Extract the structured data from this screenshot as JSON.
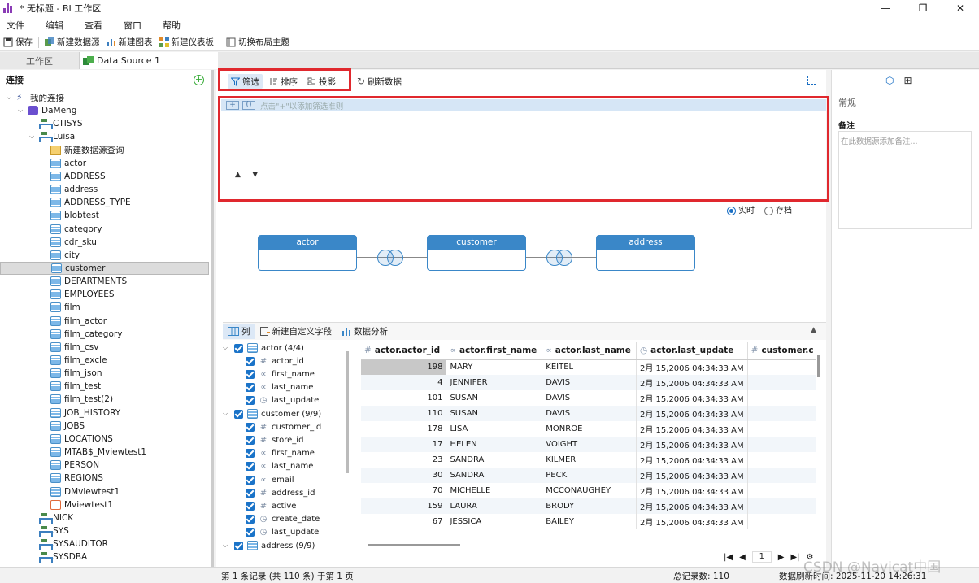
{
  "window": {
    "title": "* 无标题 - BI 工作区"
  },
  "menu": [
    "文件",
    "编辑",
    "查看",
    "窗口",
    "帮助"
  ],
  "toolbar": {
    "save": "保存",
    "new_source": "新建数据源",
    "new_chart": "新建图表",
    "new_dashboard": "新建仪表板",
    "switch_theme": "切换布局主题"
  },
  "tabs": {
    "workspace": "工作区",
    "datasource": "Data Source 1"
  },
  "left": {
    "header": "连接",
    "tree": [
      {
        "label": "我的连接",
        "level": 0,
        "icon": "plug",
        "expanded": true
      },
      {
        "label": "DaMeng",
        "level": 1,
        "icon": "conn",
        "expanded": true
      },
      {
        "label": "CTISYS",
        "level": 2,
        "icon": "schema"
      },
      {
        "label": "Luisa",
        "level": 2,
        "icon": "schema",
        "expanded": true
      },
      {
        "label": "新建数据源查询",
        "level": 3,
        "icon": "query"
      },
      {
        "label": "actor",
        "level": 3,
        "icon": "table"
      },
      {
        "label": "ADDRESS",
        "level": 3,
        "icon": "table"
      },
      {
        "label": "address",
        "level": 3,
        "icon": "table"
      },
      {
        "label": "ADDRESS_TYPE",
        "level": 3,
        "icon": "table"
      },
      {
        "label": "blobtest",
        "level": 3,
        "icon": "table"
      },
      {
        "label": "category",
        "level": 3,
        "icon": "table"
      },
      {
        "label": "cdr_sku",
        "level": 3,
        "icon": "table"
      },
      {
        "label": "city",
        "level": 3,
        "icon": "table"
      },
      {
        "label": "customer",
        "level": 3,
        "icon": "table",
        "selected": true
      },
      {
        "label": "DEPARTMENTS",
        "level": 3,
        "icon": "table"
      },
      {
        "label": "EMPLOYEES",
        "level": 3,
        "icon": "table"
      },
      {
        "label": "film",
        "level": 3,
        "icon": "table"
      },
      {
        "label": "film_actor",
        "level": 3,
        "icon": "table"
      },
      {
        "label": "film_category",
        "level": 3,
        "icon": "table"
      },
      {
        "label": "film_csv",
        "level": 3,
        "icon": "table"
      },
      {
        "label": "film_excle",
        "level": 3,
        "icon": "table"
      },
      {
        "label": "film_json",
        "level": 3,
        "icon": "table"
      },
      {
        "label": "film_test",
        "level": 3,
        "icon": "table"
      },
      {
        "label": "film_test(2)",
        "level": 3,
        "icon": "table"
      },
      {
        "label": "JOB_HISTORY",
        "level": 3,
        "icon": "table"
      },
      {
        "label": "JOBS",
        "level": 3,
        "icon": "table"
      },
      {
        "label": "LOCATIONS",
        "level": 3,
        "icon": "table"
      },
      {
        "label": "MTAB$_Mviewtest1",
        "level": 3,
        "icon": "table"
      },
      {
        "label": "PERSON",
        "level": 3,
        "icon": "table"
      },
      {
        "label": "REGIONS",
        "level": 3,
        "icon": "table"
      },
      {
        "label": "DMviewtest1",
        "level": 3,
        "icon": "table"
      },
      {
        "label": "Mviewtest1",
        "level": 3,
        "icon": "view"
      },
      {
        "label": "NICK",
        "level": 2,
        "icon": "schema"
      },
      {
        "label": "SYS",
        "level": 2,
        "icon": "schema"
      },
      {
        "label": "SYSAUDITOR",
        "level": 2,
        "icon": "schema"
      },
      {
        "label": "SYSDBA",
        "level": 2,
        "icon": "schema"
      }
    ]
  },
  "main": {
    "tools": {
      "filter": "筛选",
      "sort": "排序",
      "project": "投影",
      "refresh": "刷新数据"
    },
    "filter_hint": "点击\"+\"以添加筛选准则",
    "mode": {
      "realtime": "实时",
      "archive": "存档"
    },
    "nodes": [
      "actor",
      "customer",
      "address"
    ],
    "bottom_tabs": {
      "columns": "列",
      "new_field": "新建自定义字段",
      "analysis": "数据分析"
    },
    "fields": [
      {
        "label": "actor (4/4)",
        "group": true
      },
      {
        "label": "actor_id",
        "icon": "#"
      },
      {
        "label": "first_name",
        "icon": "abc"
      },
      {
        "label": "last_name",
        "icon": "abc"
      },
      {
        "label": "last_update",
        "icon": "clock"
      },
      {
        "label": "customer (9/9)",
        "group": true
      },
      {
        "label": "customer_id",
        "icon": "#"
      },
      {
        "label": "store_id",
        "icon": "#"
      },
      {
        "label": "first_name",
        "icon": "abc"
      },
      {
        "label": "last_name",
        "icon": "abc"
      },
      {
        "label": "email",
        "icon": "abc"
      },
      {
        "label": "address_id",
        "icon": "#"
      },
      {
        "label": "active",
        "icon": "#"
      },
      {
        "label": "create_date",
        "icon": "clock"
      },
      {
        "label": "last_update",
        "icon": "clock"
      },
      {
        "label": "address (9/9)",
        "group": true
      }
    ],
    "grid": {
      "columns": [
        {
          "label": "actor.actor_id",
          "icon": "#"
        },
        {
          "label": "actor.first_name",
          "icon": "abc"
        },
        {
          "label": "actor.last_name",
          "icon": "abc"
        },
        {
          "label": "actor.last_update",
          "icon": "clock"
        },
        {
          "label": "customer.c",
          "icon": "#"
        }
      ],
      "rows": [
        [
          "198",
          "MARY",
          "KEITEL",
          "2月 15,2006 04:34:33 AM",
          ""
        ],
        [
          "4",
          "JENNIFER",
          "DAVIS",
          "2月 15,2006 04:34:33 AM",
          ""
        ],
        [
          "101",
          "SUSAN",
          "DAVIS",
          "2月 15,2006 04:34:33 AM",
          ""
        ],
        [
          "110",
          "SUSAN",
          "DAVIS",
          "2月 15,2006 04:34:33 AM",
          ""
        ],
        [
          "178",
          "LISA",
          "MONROE",
          "2月 15,2006 04:34:33 AM",
          ""
        ],
        [
          "17",
          "HELEN",
          "VOIGHT",
          "2月 15,2006 04:34:33 AM",
          ""
        ],
        [
          "23",
          "SANDRA",
          "KILMER",
          "2月 15,2006 04:34:33 AM",
          ""
        ],
        [
          "30",
          "SANDRA",
          "PECK",
          "2月 15,2006 04:34:33 AM",
          ""
        ],
        [
          "70",
          "MICHELLE",
          "MCCONAUGHEY",
          "2月 15,2006 04:34:33 AM",
          ""
        ],
        [
          "159",
          "LAURA",
          "BRODY",
          "2月 15,2006 04:34:33 AM",
          ""
        ],
        [
          "67",
          "JESSICA",
          "BAILEY",
          "2月 15,2006 04:34:33 AM",
          ""
        ]
      ]
    },
    "pager": {
      "page": "1"
    }
  },
  "right": {
    "general": "常规",
    "notes_label": "备注",
    "notes_placeholder": "在此数据源添加备注..."
  },
  "status": {
    "record": "第 1 条记录 (共 110 条) 于第 1 页",
    "total": "总记录数: 110",
    "refresh": "数据刷新时间: 2025-11-20 14:26:31"
  },
  "watermark": "CSDN @Navicat中国"
}
